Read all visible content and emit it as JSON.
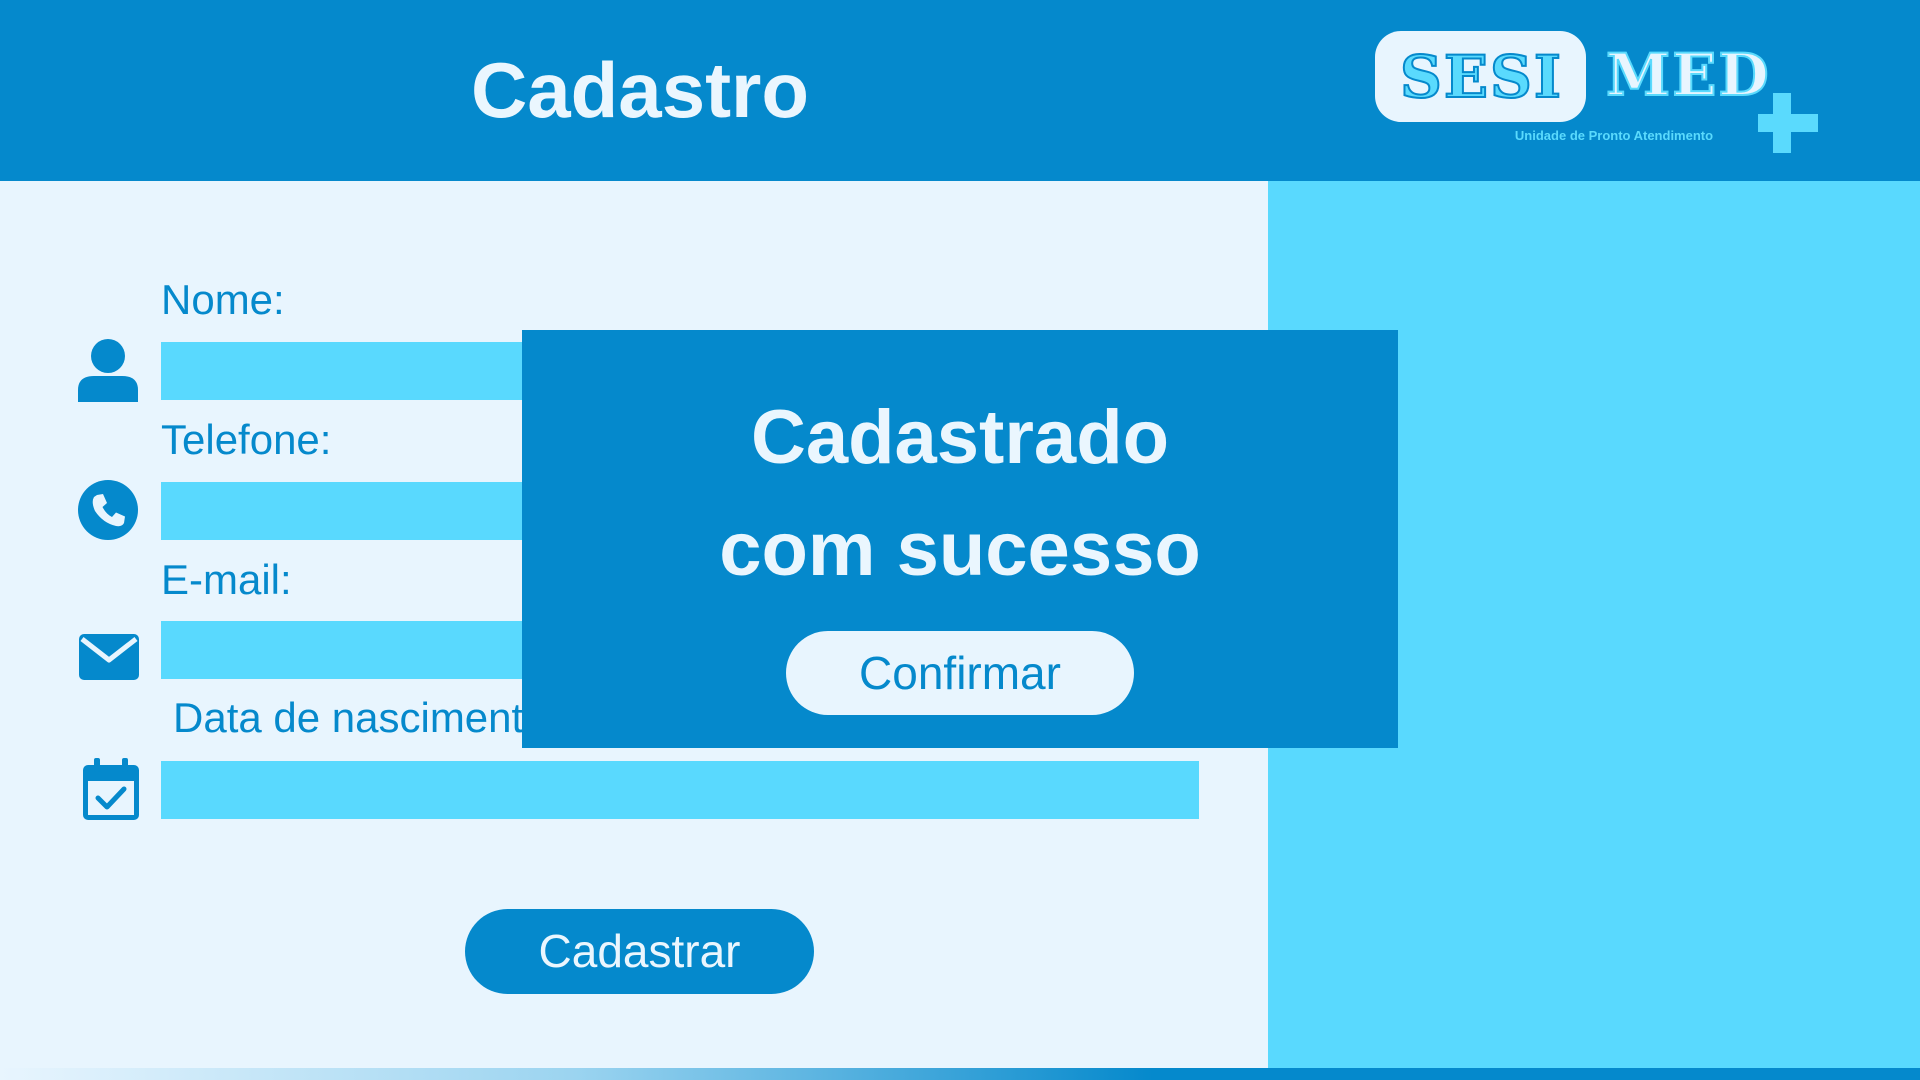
{
  "header": {
    "title": "Cadastro",
    "logo": {
      "sesi_text": "SESI",
      "med_text": "MED",
      "subtitle": "Unidade de Pronto Atendimento"
    }
  },
  "form": {
    "fields": [
      {
        "label": "Nome:",
        "icon": "user-icon",
        "value": ""
      },
      {
        "label": "Telefone:",
        "icon": "phone-icon",
        "value": ""
      },
      {
        "label": "E-mail:",
        "icon": "mail-icon",
        "value": ""
      },
      {
        "label": "Data de nascimento:",
        "icon": "calendar-check-icon",
        "value": ""
      }
    ],
    "submit_label": "Cadastrar"
  },
  "modal": {
    "title_line1": "Cadastrado",
    "title_line2": "com sucesso",
    "confirm_label": "Confirmar"
  },
  "colors": {
    "primary": "#0589CC",
    "accent": "#59D9FE",
    "background": "#E8F5FE",
    "text_light": "#EAF6FE"
  }
}
